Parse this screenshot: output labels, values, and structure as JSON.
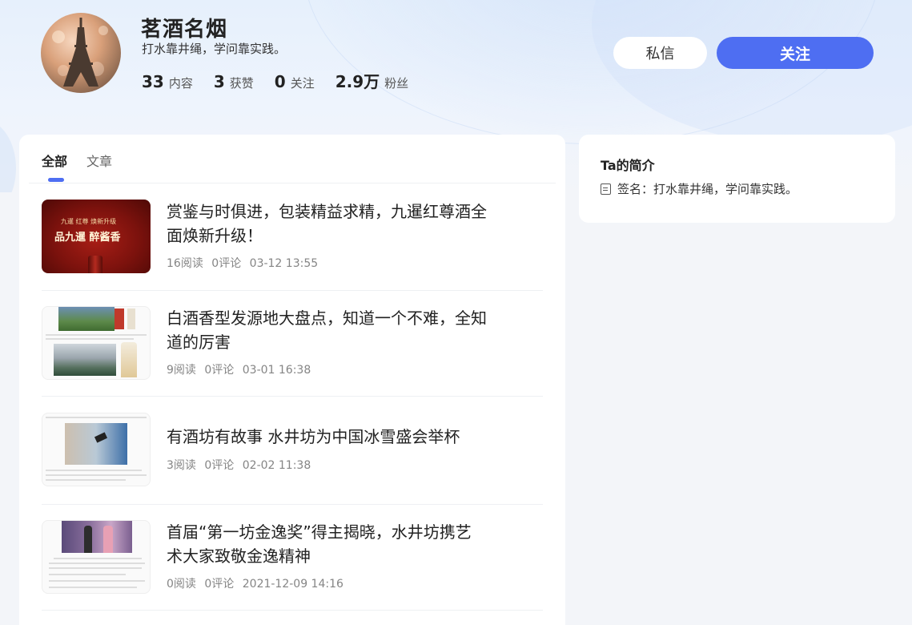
{
  "profile": {
    "name": "茗酒名烟",
    "bio": "打水靠井绳，学问靠实践。",
    "stats": [
      {
        "num": "33",
        "label": "内容"
      },
      {
        "num": "3",
        "label": "获赞"
      },
      {
        "num": "0",
        "label": "关注"
      },
      {
        "num": "2.9万",
        "label": "粉丝"
      }
    ]
  },
  "actions": {
    "message_label": "私信",
    "follow_label": "关注"
  },
  "tabs": [
    {
      "label": "全部",
      "active": true
    },
    {
      "label": "文章",
      "active": false
    }
  ],
  "articles": [
    {
      "title": "赏鉴与时俱进，包装精益求精，九暹红尊酒全面焕新升级！",
      "title_lines": [
        "赏鉴与时俱进，包装精益求精，九暹红尊酒全",
        "面焕新升级！"
      ],
      "reads": "16阅读",
      "comments": "0评论",
      "date": "03-12 13:55",
      "thumb_text": {
        "line1": "九暹 红尊 焕新升级",
        "line2": "品九暹 醉酱香"
      }
    },
    {
      "title": "白酒香型发源地大盘点，知道一个不难，全知道的厉害",
      "title_lines": [
        "白酒香型发源地大盘点，知道一个不难，全知",
        "道的厉害"
      ],
      "reads": "9阅读",
      "comments": "0评论",
      "date": "03-01 16:38"
    },
    {
      "title": "有酒坊有故事 水井坊为中国冰雪盛会举杯",
      "title_lines": [
        "有酒坊有故事 水井坊为中国冰雪盛会举杯"
      ],
      "reads": "3阅读",
      "comments": "0评论",
      "date": "02-02 11:38"
    },
    {
      "title": "首届“第一坊金逸奖”得主揭晓，水井坊携艺术大家致敬金逸精神",
      "title_lines": [
        "首届“第一坊金逸奖”得主揭晓，水井坊携艺",
        "术大家致敬金逸精神"
      ],
      "reads": "0阅读",
      "comments": "0评论",
      "date": "2021-12-09 14:16"
    }
  ],
  "sidebar": {
    "title": "Ta的简介",
    "sign_label": "签名：",
    "sign_text": "打水靠井绳，学问靠实践。"
  },
  "colors": {
    "accent": "#4e6ef2",
    "background": "#f3f5f9",
    "card": "#ffffff",
    "meta_text": "#858585"
  },
  "icons": {
    "avatar": "eiffel-tower-avatar",
    "sign": "document-icon"
  }
}
